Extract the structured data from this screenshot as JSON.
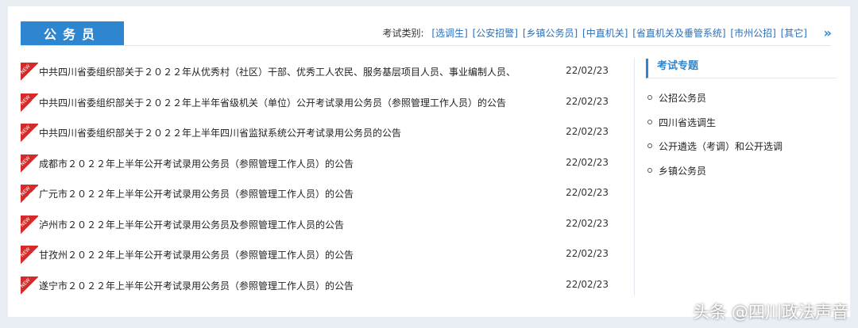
{
  "section_title": "公务员",
  "category_label": "考试类别:",
  "categories": [
    "[选调生]",
    "[公安招警]",
    "[乡镇公务员]",
    "[中直机关]",
    "[省直机关及垂管系统]",
    "[市州公招]",
    "[其它]"
  ],
  "more_icon": "»",
  "new_badge": "NEW",
  "news": [
    {
      "title": "中共四川省委组织部关于２０２２年从优秀村（社区）干部、优秀工人农民、服务基层项目人员、事业编制人员、",
      "date": "22/02/23"
    },
    {
      "title": "中共四川省委组织部关于２０２２年上半年省级机关（单位）公开考试录用公务员（参照管理工作人员）的公告",
      "date": "22/02/23"
    },
    {
      "title": "中共四川省委组织部关于２０２２年上半年四川省监狱系统公开考试录用公务员的公告",
      "date": "22/02/23"
    },
    {
      "title": "成都市２０２２年上半年公开考试录用公务员（参照管理工作人员）的公告",
      "date": "22/02/23"
    },
    {
      "title": "广元市２０２２年上半年公开考试录用公务员（参照管理工作人员）的公告",
      "date": "22/02/23"
    },
    {
      "title": "泸州市２０２２年上半年公开考试录用公务员及参照管理工作人员的公告",
      "date": "22/02/23"
    },
    {
      "title": "甘孜州２０２２年上半年公开考试录用公务员（参照管理工作人员）的公告",
      "date": "22/02/23"
    },
    {
      "title": "遂宁市２０２２年上半年公开考试录用公务员（参照管理工作人员）的公告",
      "date": "22/02/23"
    }
  ],
  "sidebar": {
    "title": "考试专题",
    "items": [
      "公招公务员",
      "四川省选调生",
      "公开遴选（考调）和公开选调",
      "乡镇公务员"
    ]
  },
  "watermark": "头条 @四川政法声音"
}
